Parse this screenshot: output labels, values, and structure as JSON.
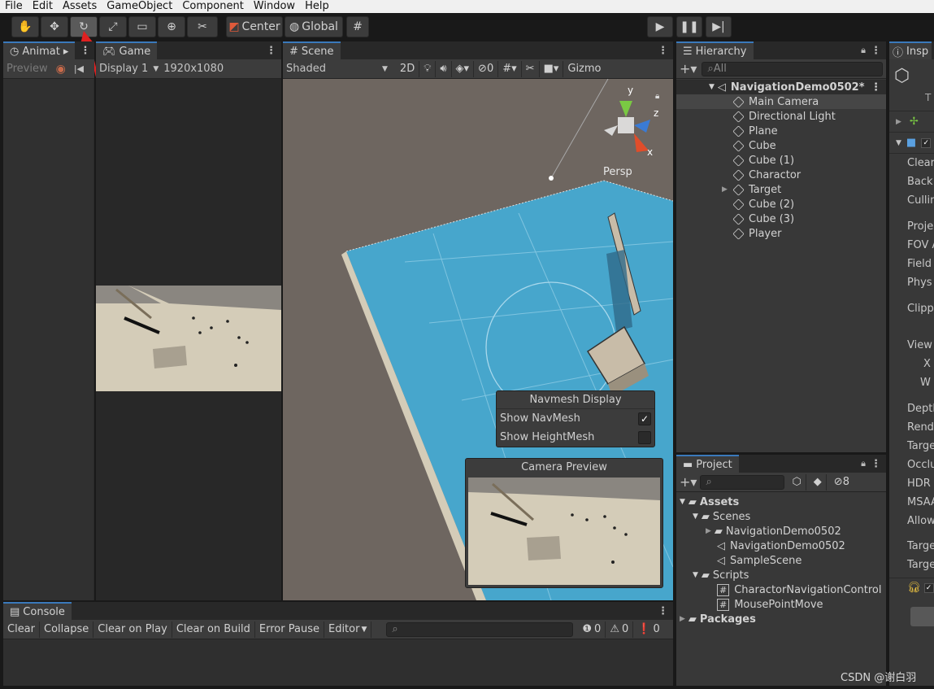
{
  "menu": [
    "File",
    "Edit",
    "Assets",
    "GameObject",
    "Component",
    "Window",
    "Help"
  ],
  "toolbar": {
    "pivot_label": "Center",
    "space_label": "Global"
  },
  "animation_panel": {
    "tab_label": "Animat",
    "preview_label": "Preview"
  },
  "game_panel": {
    "tab_label": "Game",
    "display_label": "Display 1",
    "resolution": "1920x1080"
  },
  "scene_panel": {
    "tab_label": "Scene",
    "shading_mode": "Shaded",
    "mode_2d": "2D",
    "hidden_count": "0",
    "gizmos_label": "Gizmo",
    "persp_label": "Persp",
    "axis_y": "y",
    "axis_z": "z",
    "axis_x": "x"
  },
  "navmesh_display": {
    "title": "Navmesh Display",
    "show_navmesh_label": "Show NavMesh",
    "show_navmesh_checked": true,
    "show_heightmesh_label": "Show HeightMesh",
    "show_heightmesh_checked": false
  },
  "camera_preview": {
    "title": "Camera Preview"
  },
  "hierarchy": {
    "tab_label": "Hierarchy",
    "search_placeholder": "All",
    "scene_name": "NavigationDemo0502*",
    "items": [
      {
        "label": "Main Camera",
        "selected": true
      },
      {
        "label": "Directional Light"
      },
      {
        "label": "Plane"
      },
      {
        "label": "Cube"
      },
      {
        "label": "Cube (1)"
      },
      {
        "label": "Charactor"
      },
      {
        "label": "Target",
        "has_children": true
      },
      {
        "label": "Cube (2)"
      },
      {
        "label": "Cube (3)"
      },
      {
        "label": "Player"
      }
    ]
  },
  "project": {
    "tab_label": "Project",
    "hidden_count": "8",
    "assets_label": "Assets",
    "scenes_label": "Scenes",
    "scene_folder": "NavigationDemo0502",
    "scene_file": "NavigationDemo0502",
    "sample_scene": "SampleScene",
    "scripts_label": "Scripts",
    "script1": "CharactorNavigationControl",
    "script2": "MousePointMove",
    "packages_label": "Packages"
  },
  "inspector": {
    "tab_label": "Insp",
    "rows": [
      "Clear",
      "Back",
      "Cullin",
      "Proje",
      "FOV A",
      "Field",
      "Phys",
      "Clipp",
      "View",
      "X",
      "W",
      "Depth",
      "Rend",
      "Targe",
      "Occlu",
      "HDR",
      "MSAA",
      "Allow",
      "Targe",
      "Targe"
    ]
  },
  "console": {
    "tab_label": "Console",
    "buttons": [
      "Clear",
      "Collapse",
      "Clear on Play",
      "Clear on Build",
      "Error Pause",
      "Editor"
    ],
    "log_count": "0",
    "warning_count": "0",
    "error_count": "0"
  },
  "watermark": "CSDN @谢白羽",
  "colors": {
    "accent": "#3a79bb",
    "navmesh": "#4aa8cf",
    "ground": "#d4ccb8"
  }
}
